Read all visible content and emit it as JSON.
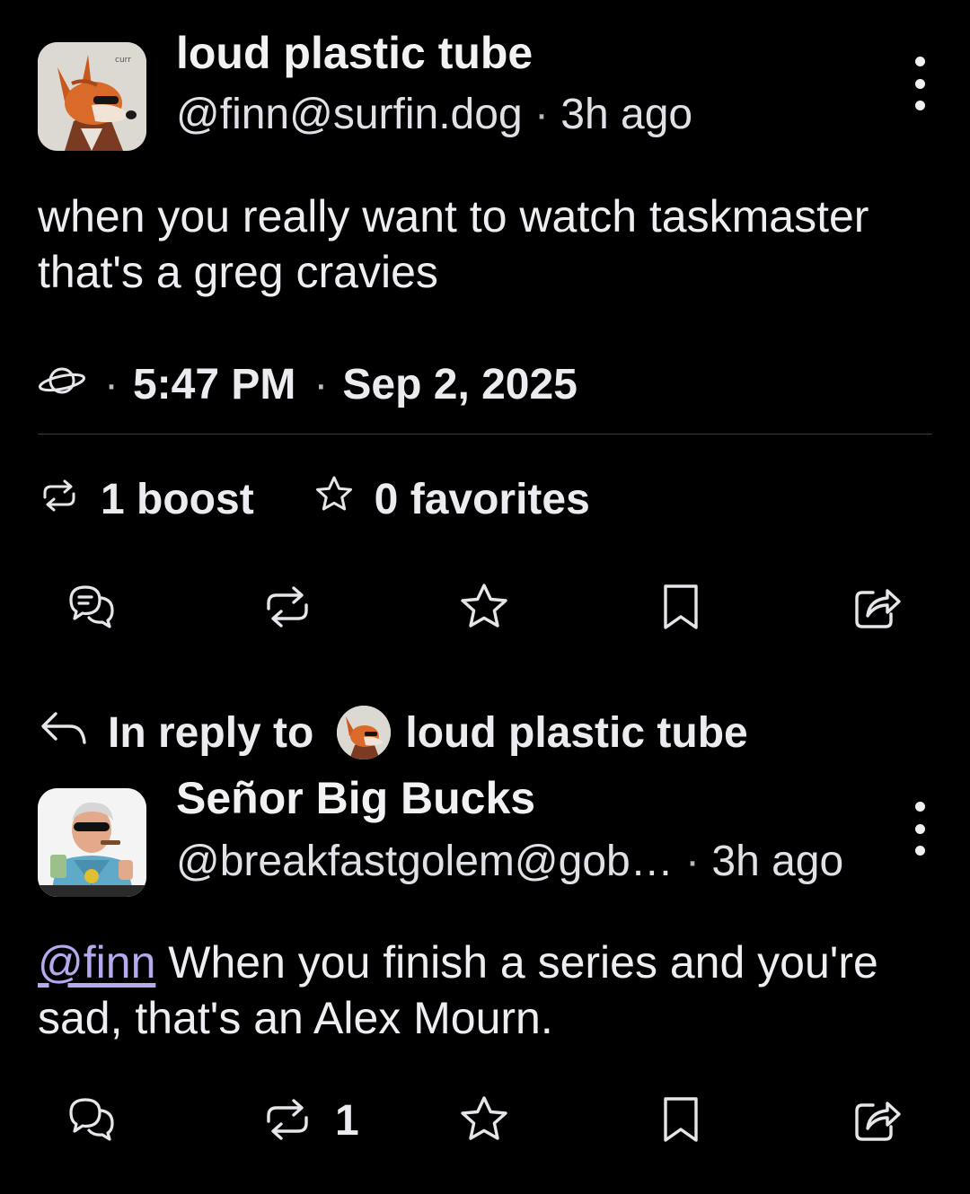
{
  "post1": {
    "author_name": "loud plastic tube",
    "handle": "@finn@surfin.dog",
    "time_ago": "3h ago",
    "content": "when you really want to watch taskmaster that's a greg cravies",
    "visibility_icon": "globe-icon",
    "time": "5:47 PM",
    "date": "Sep 2, 2025",
    "boosts_label": "1 boost",
    "favorites_label": "0 favorites"
  },
  "reply_context": {
    "prefix": "In reply to",
    "target_name": "loud plastic tube"
  },
  "post2": {
    "author_name": "Señor Big Bucks",
    "handle": "@breakfastgolem@gob…",
    "time_ago": "3h ago",
    "mention": "@finn",
    "content": " When you finish a series and you're sad, that's an Alex Mourn.",
    "boost_count": "1"
  },
  "icons": {
    "reply": "reply-icon",
    "boost": "boost-icon",
    "favorite": "star-icon",
    "bookmark": "bookmark-icon",
    "share": "share-icon",
    "more": "more-vertical-icon"
  },
  "colors": {
    "background": "#000000",
    "text": "#e9e9ec",
    "mention": "#b7a9f0",
    "divider": "#3a3a40"
  }
}
